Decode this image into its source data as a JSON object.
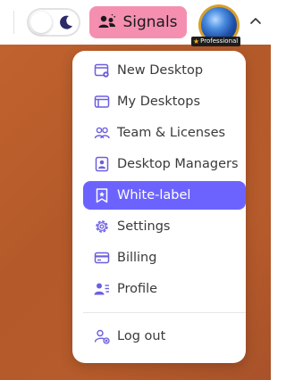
{
  "header": {
    "theme_toggle": {
      "state": "dark"
    },
    "signals_label": "Signals",
    "avatar_badge": "Professional"
  },
  "menu": {
    "items": [
      {
        "label": "New Desktop",
        "icon": "new-desktop-icon"
      },
      {
        "label": "My Desktops",
        "icon": "desktops-icon"
      },
      {
        "label": "Team & Licenses",
        "icon": "team-icon"
      },
      {
        "label": "Desktop Managers",
        "icon": "manager-icon"
      },
      {
        "label": "White-label",
        "icon": "bookmark-star-icon",
        "active": true
      },
      {
        "label": "Settings",
        "icon": "gear-icon"
      },
      {
        "label": "Billing",
        "icon": "card-icon"
      },
      {
        "label": "Profile",
        "icon": "profile-icon"
      }
    ],
    "logout_label": "Log out"
  },
  "colors": {
    "accent": "#6c63ff",
    "icon_purple": "#6b5fe0",
    "signals_bg": "#f58fb0",
    "background": "#b65b2b"
  }
}
